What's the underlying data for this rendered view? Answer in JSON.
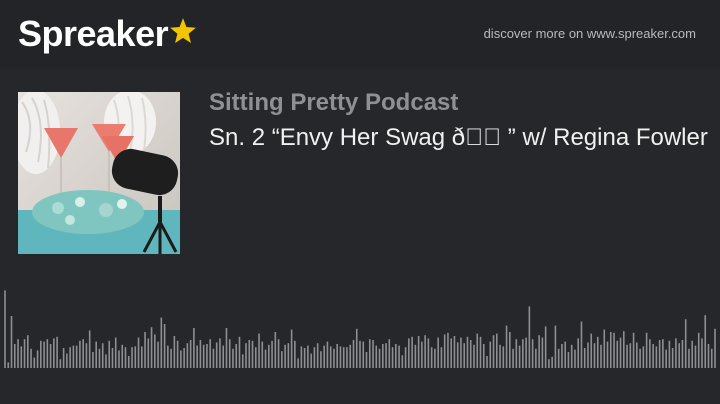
{
  "header": {
    "logo_text": "Spreaker",
    "logo_star_color": "#f5c400",
    "discover_link": "discover more on www.spreaker.com"
  },
  "episode": {
    "podcast_title": "Sitting Pretty Podcast",
    "title": "Sn. 2 “Envy Her Swag ð\u0000\u0000 ” w/ Regina Fowler",
    "cover_icon": "podcast-cover-image"
  },
  "waveform": {
    "color": "#8e8f93",
    "levels": [
      0.97,
      0.07,
      0.65,
      0.3,
      0.36,
      0.27,
      0.36,
      0.41,
      0.24,
      0.13,
      0.22,
      0.34,
      0.33,
      0.36,
      0.3,
      0.37,
      0.39,
      0.11,
      0.25,
      0.18,
      0.26,
      0.28,
      0.28,
      0.34,
      0.36,
      0.31,
      0.47,
      0.2,
      0.33,
      0.24,
      0.31,
      0.17,
      0.34,
      0.25,
      0.38,
      0.22,
      0.29,
      0.26,
      0.15,
      0.26,
      0.27,
      0.38,
      0.27,
      0.45,
      0.37,
      0.51,
      0.42,
      0.33,
      0.63,
      0.55,
      0.28,
      0.24,
      0.4,
      0.34,
      0.22,
      0.25,
      0.31,
      0.35,
      0.5,
      0.28,
      0.35,
      0.29,
      0.3,
      0.36,
      0.24,
      0.32,
      0.37,
      0.28,
      0.5,
      0.36,
      0.24,
      0.3,
      0.39,
      0.17,
      0.31,
      0.35,
      0.34,
      0.26,
      0.43,
      0.33,
      0.23,
      0.29,
      0.34,
      0.45,
      0.36,
      0.21,
      0.29,
      0.31,
      0.48,
      0.34,
      0.12,
      0.27,
      0.25,
      0.28,
      0.18,
      0.26,
      0.31,
      0.21,
      0.28,
      0.33,
      0.27,
      0.24,
      0.3,
      0.27,
      0.26,
      0.26,
      0.29,
      0.35,
      0.49,
      0.34,
      0.33,
      0.2,
      0.36,
      0.35,
      0.28,
      0.24,
      0.3,
      0.31,
      0.36,
      0.26,
      0.3,
      0.28,
      0.16,
      0.26,
      0.37,
      0.39,
      0.29,
      0.4,
      0.33,
      0.41,
      0.37,
      0.26,
      0.24,
      0.38,
      0.26,
      0.42,
      0.44,
      0.37,
      0.4,
      0.32,
      0.38,
      0.31,
      0.39,
      0.35,
      0.29,
      0.43,
      0.39,
      0.3,
      0.15,
      0.33,
      0.41,
      0.43,
      0.29,
      0.27,
      0.53,
      0.45,
      0.24,
      0.36,
      0.28,
      0.36,
      0.38,
      0.77,
      0.36,
      0.24,
      0.41,
      0.38,
      0.52,
      0.11,
      0.14,
      0.53,
      0.24,
      0.3,
      0.33,
      0.2,
      0.29,
      0.23,
      0.37,
      0.58,
      0.25,
      0.32,
      0.43,
      0.31,
      0.39,
      0.29,
      0.48,
      0.33,
      0.45,
      0.44,
      0.34,
      0.38,
      0.46,
      0.29,
      0.31,
      0.44,
      0.32,
      0.24,
      0.27,
      0.44,
      0.36,
      0.3,
      0.27,
      0.35,
      0.36,
      0.23,
      0.34,
      0.25,
      0.37,
      0.31,
      0.35,
      0.61,
      0.24,
      0.34,
      0.28,
      0.44,
      0.37,
      0.66,
      0.3,
      0.24,
      0.49
    ]
  }
}
